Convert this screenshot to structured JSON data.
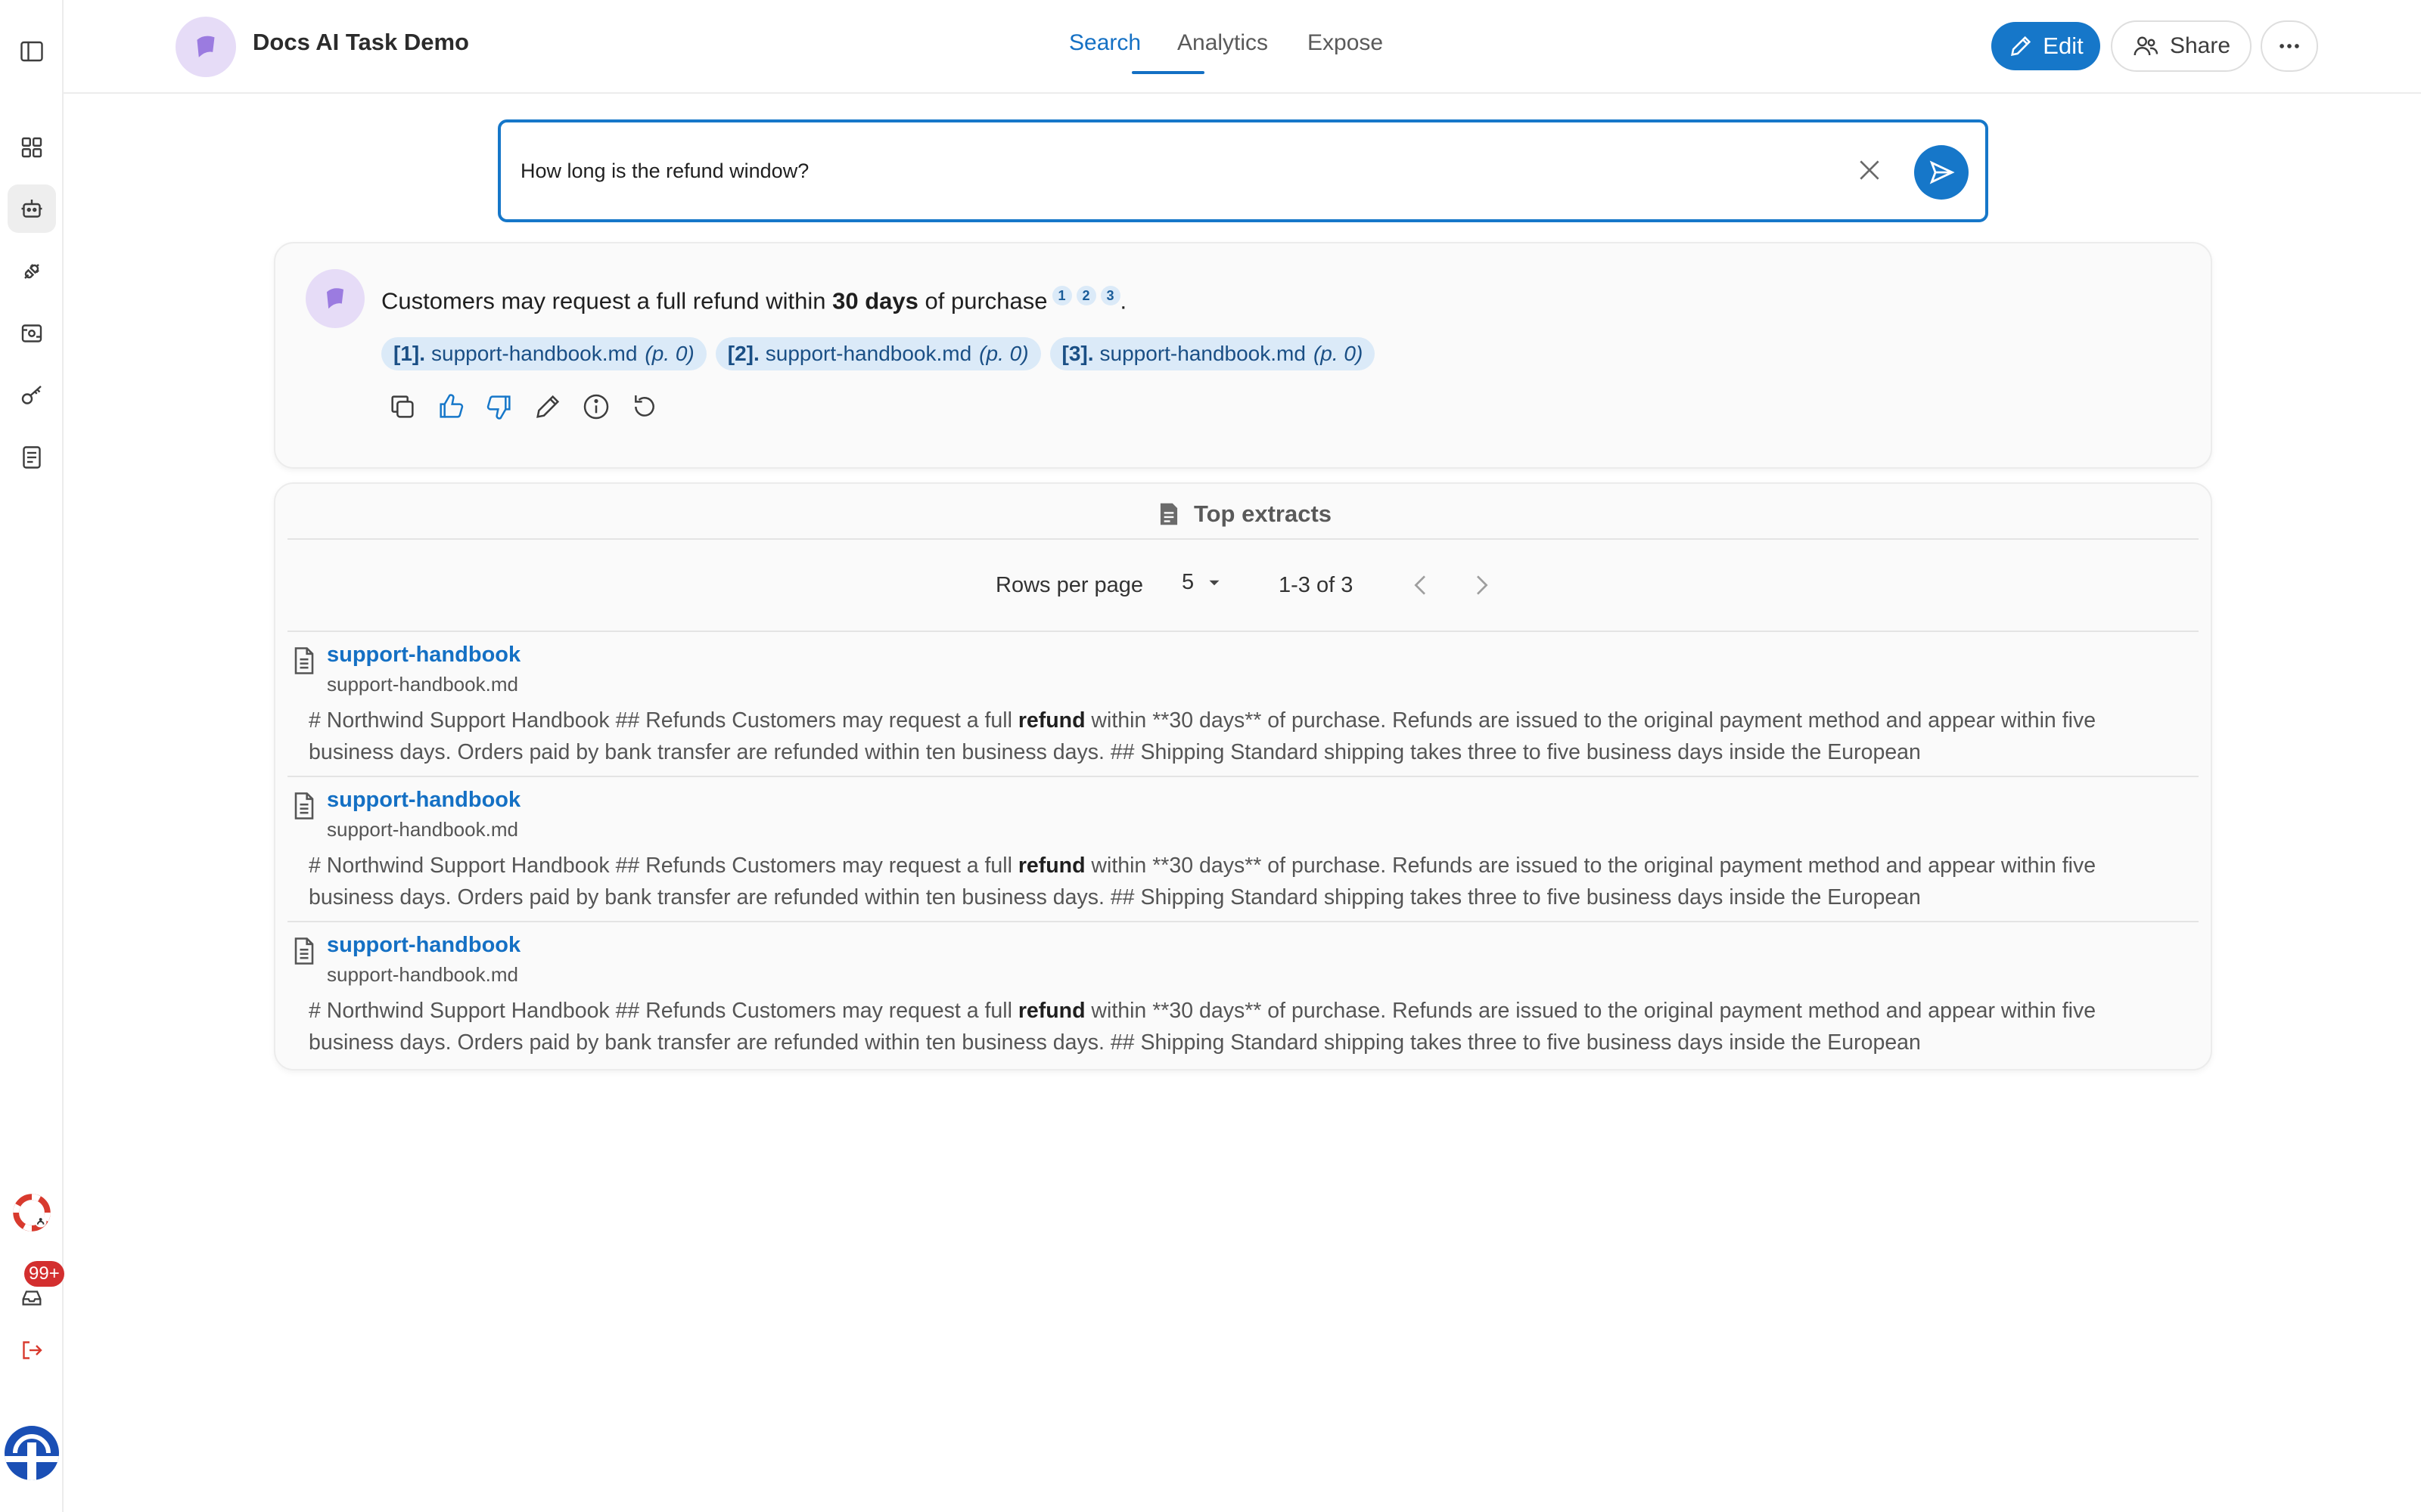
{
  "app": {
    "title": "Docs AI Task Demo"
  },
  "tabs": [
    {
      "label": "Search",
      "active": true
    },
    {
      "label": "Analytics",
      "active": false
    },
    {
      "label": "Expose",
      "active": false
    }
  ],
  "header_actions": {
    "edit": "Edit",
    "share": "Share"
  },
  "sidebar": {
    "icons": [
      "panel-toggle-icon",
      "grid-icon",
      "robot-icon",
      "plug-icon",
      "scan-icon",
      "key-icon",
      "document-icon",
      "support-icon",
      "inbox-icon",
      "logout-icon",
      "user-avatar"
    ],
    "inbox_badge": "99+"
  },
  "search": {
    "value": "How long is the refund window?"
  },
  "answer": {
    "text_before": "Customers may request a full refund within ",
    "text_bold": "30 days",
    "text_after": " of purchase",
    "citation_marks": [
      "1",
      "2",
      "3"
    ],
    "period": ".",
    "sources": [
      {
        "num": "[1].",
        "file": "support-handbook.md",
        "page": "(p. 0)"
      },
      {
        "num": "[2].",
        "file": "support-handbook.md",
        "page": "(p. 0)"
      },
      {
        "num": "[3].",
        "file": "support-handbook.md",
        "page": "(p. 0)"
      }
    ],
    "actions": [
      "copy-icon",
      "thumbs-up-icon",
      "thumbs-down-icon",
      "pencil-icon",
      "info-icon",
      "refresh-icon"
    ]
  },
  "extracts": {
    "title": "Top extracts",
    "rows_per_page_label": "Rows per page",
    "rows_per_page_value": "5",
    "range": "1-3 of 3",
    "rows": [
      {
        "title": "support-handbook",
        "file": "support-handbook.md",
        "before": "# Northwind Support Handbook ## Refunds Customers may request a full ",
        "highlight": "refund",
        "after": " within **30 days** of purchase. Refunds are issued to the original payment method and appear within five business days. Orders paid by bank transfer are refunded within ten business days. ## Shipping Standard shipping takes three to five business days inside the European"
      },
      {
        "title": "support-handbook",
        "file": "support-handbook.md",
        "before": "# Northwind Support Handbook ## Refunds Customers may request a full ",
        "highlight": "refund",
        "after": " within **30 days** of purchase. Refunds are issued to the original payment method and appear within five business days. Orders paid by bank transfer are refunded within ten business days. ## Shipping Standard shipping takes three to five business days inside the European"
      },
      {
        "title": "support-handbook",
        "file": "support-handbook.md",
        "before": "# Northwind Support Handbook ## Refunds Customers may request a full ",
        "highlight": "refund",
        "after": " within **30 days** of purchase. Refunds are issued to the original payment method and appear within five business days. Orders paid by bank transfer are refunded within ten business days. ## Shipping Standard shipping takes three to five business days inside the European"
      }
    ]
  },
  "colors": {
    "accent": "#1677c9",
    "chip_bg": "#dbeaf8",
    "logo_bg": "#e6dcf7",
    "logo_fg": "#9b7be0"
  }
}
